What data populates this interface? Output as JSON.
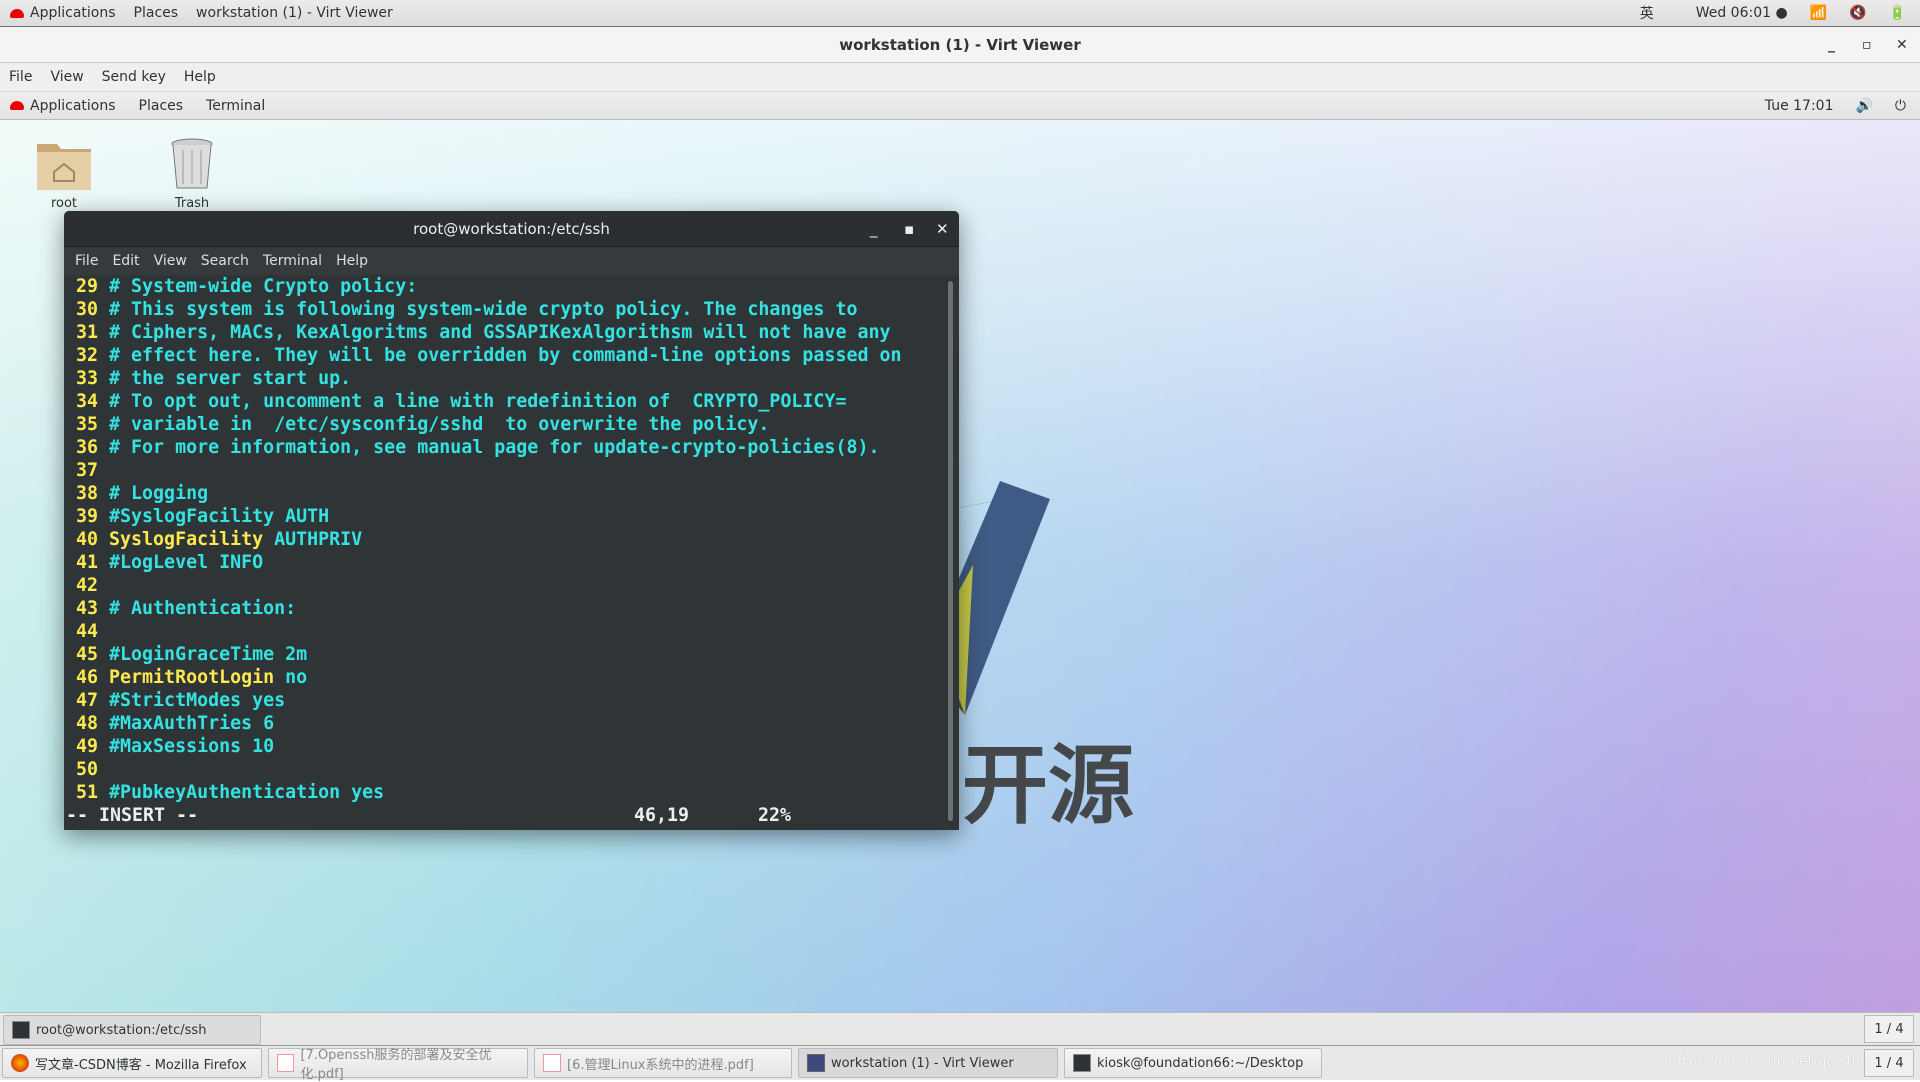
{
  "host_panel": {
    "applications": "Applications",
    "places": "Places",
    "window": "workstation (1) - Virt Viewer",
    "input_method": "英",
    "clock": "Wed 06:01"
  },
  "virt_viewer": {
    "title": "workstation (1) - Virt Viewer",
    "menu": [
      "File",
      "View",
      "Send key",
      "Help"
    ]
  },
  "guest_panel": {
    "applications": "Applications",
    "places": "Places",
    "terminal": "Terminal",
    "clock": "Tue 17:01"
  },
  "desktop_icons": [
    {
      "label": "root",
      "icon": "home-folder-icon"
    },
    {
      "label": "Trash",
      "icon": "trash-icon"
    }
  ],
  "watermark": "西部开源",
  "terminal": {
    "title": "root@workstation:/etc/ssh",
    "menu": [
      "File",
      "Edit",
      "View",
      "Search",
      "Terminal",
      "Help"
    ],
    "lines": [
      {
        "n": "29",
        "text": "# System-wide Crypto policy:"
      },
      {
        "n": "30",
        "text": "# This system is following system-wide crypto policy. The changes to"
      },
      {
        "n": "31",
        "text": "# Ciphers, MACs, KexAlgoritms and GSSAPIKexAlgorithsm will not have any"
      },
      {
        "n": "32",
        "text": "# effect here. They will be overridden by command-line options passed on"
      },
      {
        "n": "33",
        "text": "# the server start up."
      },
      {
        "n": "34",
        "text": "# To opt out, uncomment a line with redefinition of  CRYPTO_POLICY="
      },
      {
        "n": "35",
        "text": "# variable in  /etc/sysconfig/sshd  to overwrite the policy."
      },
      {
        "n": "36",
        "text": "# For more information, see manual page for update-crypto-policies(8)."
      },
      {
        "n": "37",
        "text": ""
      },
      {
        "n": "38",
        "text": "# Logging"
      },
      {
        "n": "39",
        "text": "#SyslogFacility AUTH"
      },
      {
        "n": "40",
        "key": "SyslogFacility",
        "value": "AUTHPRIV"
      },
      {
        "n": "41",
        "text": "#LogLevel INFO"
      },
      {
        "n": "42",
        "text": ""
      },
      {
        "n": "43",
        "text": "# Authentication:"
      },
      {
        "n": "44",
        "text": ""
      },
      {
        "n": "45",
        "text": "#LoginGraceTime 2m"
      },
      {
        "n": "46",
        "key": "PermitRootLogin",
        "value": "no"
      },
      {
        "n": "47",
        "text": "#StrictModes yes"
      },
      {
        "n": "48",
        "text": "#MaxAuthTries 6"
      },
      {
        "n": "49",
        "text": "#MaxSessions 10"
      },
      {
        "n": "50",
        "text": ""
      },
      {
        "n": "51",
        "text": "#PubkeyAuthentication yes"
      }
    ],
    "mode": "-- INSERT --",
    "position": "46,19",
    "percent": "22%"
  },
  "guest_taskbar": {
    "window": "root@workstation:/etc/ssh",
    "pager": "1 / 4"
  },
  "host_taskbar": {
    "items": [
      "写文章-CSDN博客 - Mozilla Firefox",
      "[7.Openssh服务的部署及安全优化.pdf]",
      "[6.管理Linux系统中的进程.pdf]",
      "workstation (1) - Virt Viewer",
      "kiosk@foundation66:~/Desktop"
    ],
    "pager": "1 / 4",
    "watermark_url": "https://blog.csdn.net/qq_46089299"
  }
}
